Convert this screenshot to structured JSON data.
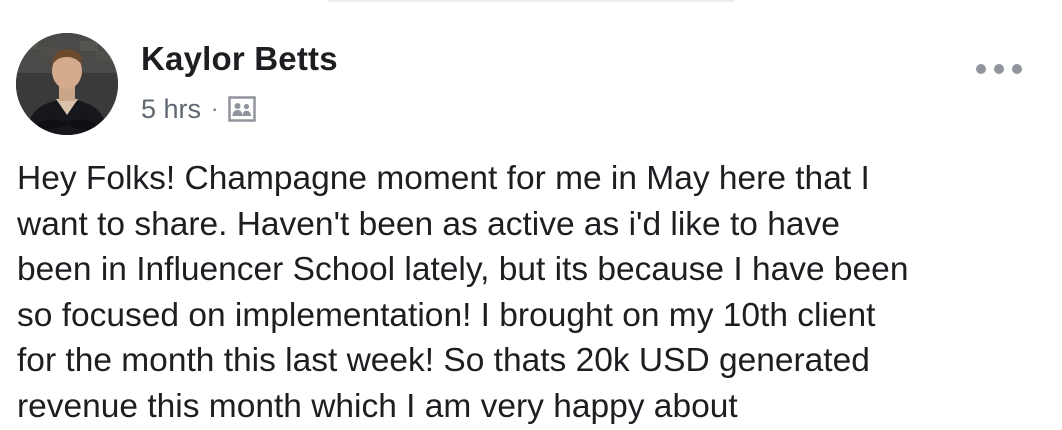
{
  "post": {
    "author": "Kaylor Betts",
    "time": "5 hrs",
    "separator": "·",
    "audience_icon": "group-members-icon",
    "more_icon": "ellipsis-icon",
    "text_lines": [
      "Hey Folks! Champagne moment for me in May here that I",
      "want to share. Haven't been as active as i'd like to have",
      "been in Influencer School lately, but its because I have been",
      "so focused on implementation! I brought on my 10th client",
      "for the month this last week! So thats 20k USD generated",
      "revenue this month which I am very happy about"
    ]
  },
  "colors": {
    "text": "#1c1e21",
    "meta": "#606770",
    "icon": "#90949c"
  }
}
